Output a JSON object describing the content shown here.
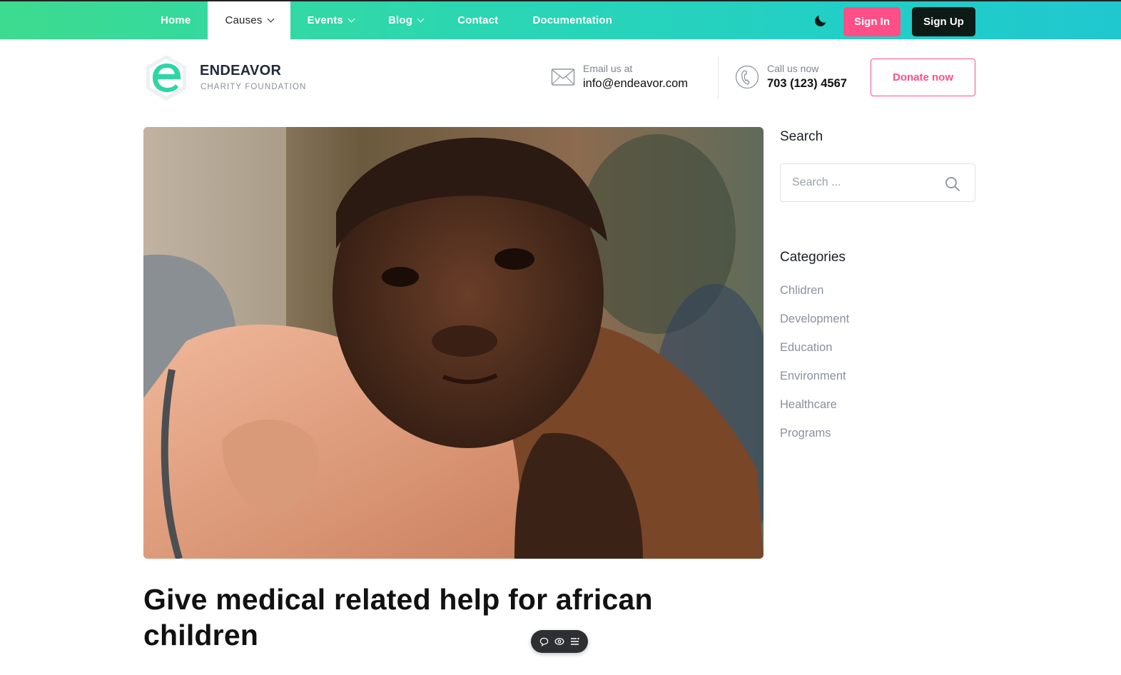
{
  "nav": {
    "items": [
      {
        "label": "Home",
        "dropdown": false,
        "active": false
      },
      {
        "label": "Causes",
        "dropdown": true,
        "active": true
      },
      {
        "label": "Events",
        "dropdown": true,
        "active": false
      },
      {
        "label": "Blog",
        "dropdown": true,
        "active": false
      },
      {
        "label": "Contact",
        "dropdown": false,
        "active": false
      },
      {
        "label": "Documentation",
        "dropdown": false,
        "active": false
      }
    ],
    "theme_toggle_icon": "moon-icon",
    "signin_label": "Sign In",
    "signup_label": "Sign Up"
  },
  "header": {
    "brand": "ENDEAVOR",
    "brand_sub": "CHARITY FOUNDATION",
    "email_label": "Email us at",
    "email_value": "info@endeavor.com",
    "phone_label": "Call us now",
    "phone_value": "703 (123) 4567",
    "donate_label": "Donate now"
  },
  "post": {
    "title": "Give medical related help for african children",
    "image_description_icon": "hero-photo"
  },
  "sidebar": {
    "search_title": "Search",
    "search_placeholder": "Search ...",
    "categories_title": "Categories",
    "categories": [
      "Chlidren",
      "Development",
      "Education",
      "Environment",
      "Healthcare",
      "Programs"
    ]
  },
  "floating_toolbar": {
    "icons": [
      "comment-icon",
      "eye-icon",
      "list-icon"
    ]
  },
  "colors": {
    "accent_green": "#2ed6a4",
    "accent_pink": "#ff4f86",
    "dark": "#0e1a16"
  }
}
